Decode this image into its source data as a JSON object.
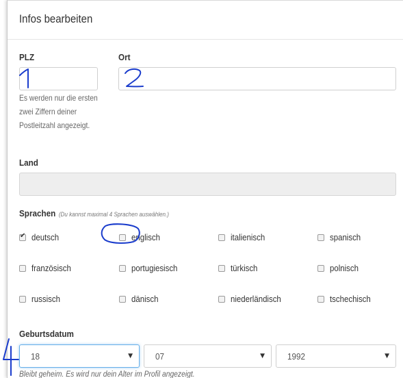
{
  "dialog": {
    "title": "Infos bearbeiten"
  },
  "plz": {
    "label": "PLZ",
    "value": "",
    "help": "Es werden nur die ersten zwei Ziffern deiner Postleitzahl angezeigt."
  },
  "ort": {
    "label": "Ort",
    "value": ""
  },
  "land": {
    "label": "Land",
    "value": ""
  },
  "sprachen": {
    "label": "Sprachen",
    "hint": "(Du kannst maximal 4 Sprachen auswählen.)",
    "options": [
      {
        "label": "deutsch",
        "checked": true
      },
      {
        "label": "englisch",
        "checked": false
      },
      {
        "label": "italienisch",
        "checked": false
      },
      {
        "label": "spanisch",
        "checked": false
      },
      {
        "label": "französisch",
        "checked": false
      },
      {
        "label": "portugiesisch",
        "checked": false
      },
      {
        "label": "türkisch",
        "checked": false
      },
      {
        "label": "polnisch",
        "checked": false
      },
      {
        "label": "russisch",
        "checked": false
      },
      {
        "label": "dänisch",
        "checked": false
      },
      {
        "label": "niederländisch",
        "checked": false
      },
      {
        "label": "tschechisch",
        "checked": false
      }
    ]
  },
  "geburtsdatum": {
    "label": "Geburtsdatum",
    "day": "18",
    "month": "07",
    "year": "1992",
    "help": "Bleibt geheim. Es wird nur dein Alter im Profil angezeigt."
  },
  "colors": {
    "annotation_ink": "#1a3ccc",
    "focus_border": "#66afe9",
    "disabled_bg": "#eeeeee"
  },
  "annotations": {
    "marks": [
      "1",
      "2",
      "4"
    ]
  }
}
